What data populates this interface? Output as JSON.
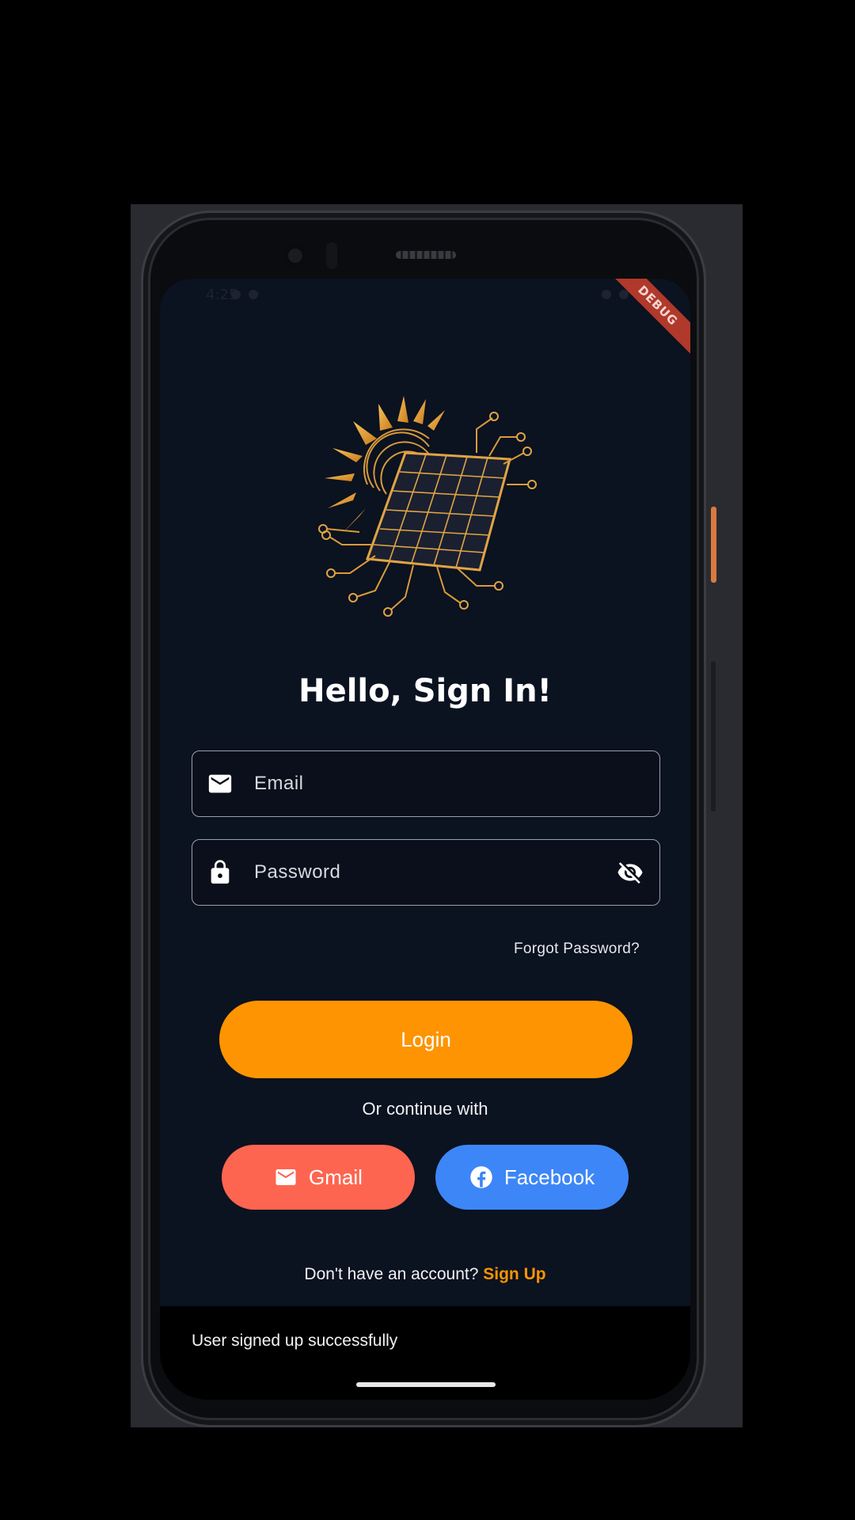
{
  "device": {
    "debug_banner": "DEBUG"
  },
  "status_bar": {
    "time": "4:25"
  },
  "login": {
    "title": "Hello, Sign In!",
    "email_placeholder": "Email",
    "password_placeholder": "Password",
    "forgot_password": "Forgot Password?",
    "login_button": "Login",
    "or_continue": "Or continue with",
    "gmail_button": "Gmail",
    "facebook_button": "Facebook",
    "no_account_text": "Don't have an account?",
    "signup_link": "Sign Up"
  },
  "snackbar": {
    "message": "User signed up successfully"
  },
  "icons": {
    "email_field": "mail-icon",
    "password_field": "lock-icon",
    "visibility": "eye-off-icon",
    "gmail": "mail-icon",
    "facebook": "facebook-icon"
  },
  "colors": {
    "background": "#0b1220",
    "accent_orange": "#fe9401",
    "gmail_red": "#fd6550",
    "facebook_blue": "#3d86f7",
    "debug_red": "#b0392b"
  }
}
